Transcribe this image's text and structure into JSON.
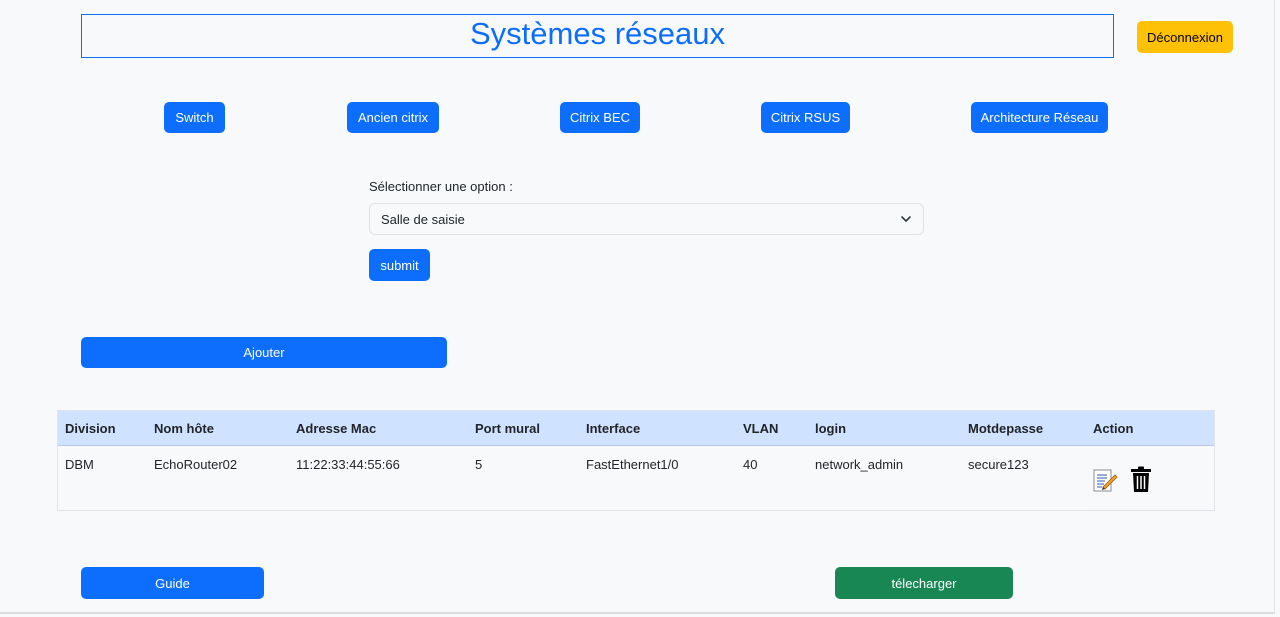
{
  "header": {
    "title": "Systèmes réseaux",
    "logout_label": "Déconnexion"
  },
  "nav": {
    "items": [
      {
        "label": "Switch"
      },
      {
        "label": "Ancien citrix"
      },
      {
        "label": "Citrix BEC"
      },
      {
        "label": "Citrix RSUS"
      },
      {
        "label": "Architecture Réseau"
      }
    ]
  },
  "form": {
    "label": "Sélectionner une option :",
    "selected_option": "Salle de saisie",
    "submit_label": "submit"
  },
  "add_label": "Ajouter",
  "table": {
    "headers": [
      "Division",
      "Nom hôte",
      "Adresse Mac",
      "Port mural",
      "Interface",
      "VLAN",
      "login",
      "Motdepasse",
      "Action"
    ],
    "rows": [
      {
        "cells": [
          "DBM",
          "EchoRouter02",
          "11:22:33:44:55:66",
          "5",
          "FastEthernet1/0",
          "40",
          "network_admin",
          "secure123"
        ],
        "actions": [
          "edit-icon",
          "trash-icon"
        ]
      }
    ]
  },
  "footer": {
    "guide_label": "Guide",
    "download_label": "télecharger"
  },
  "colors": {
    "primary": "#0d6efd",
    "warning": "#ffc107",
    "success": "#198754",
    "table_header": "#cfe2ff"
  }
}
